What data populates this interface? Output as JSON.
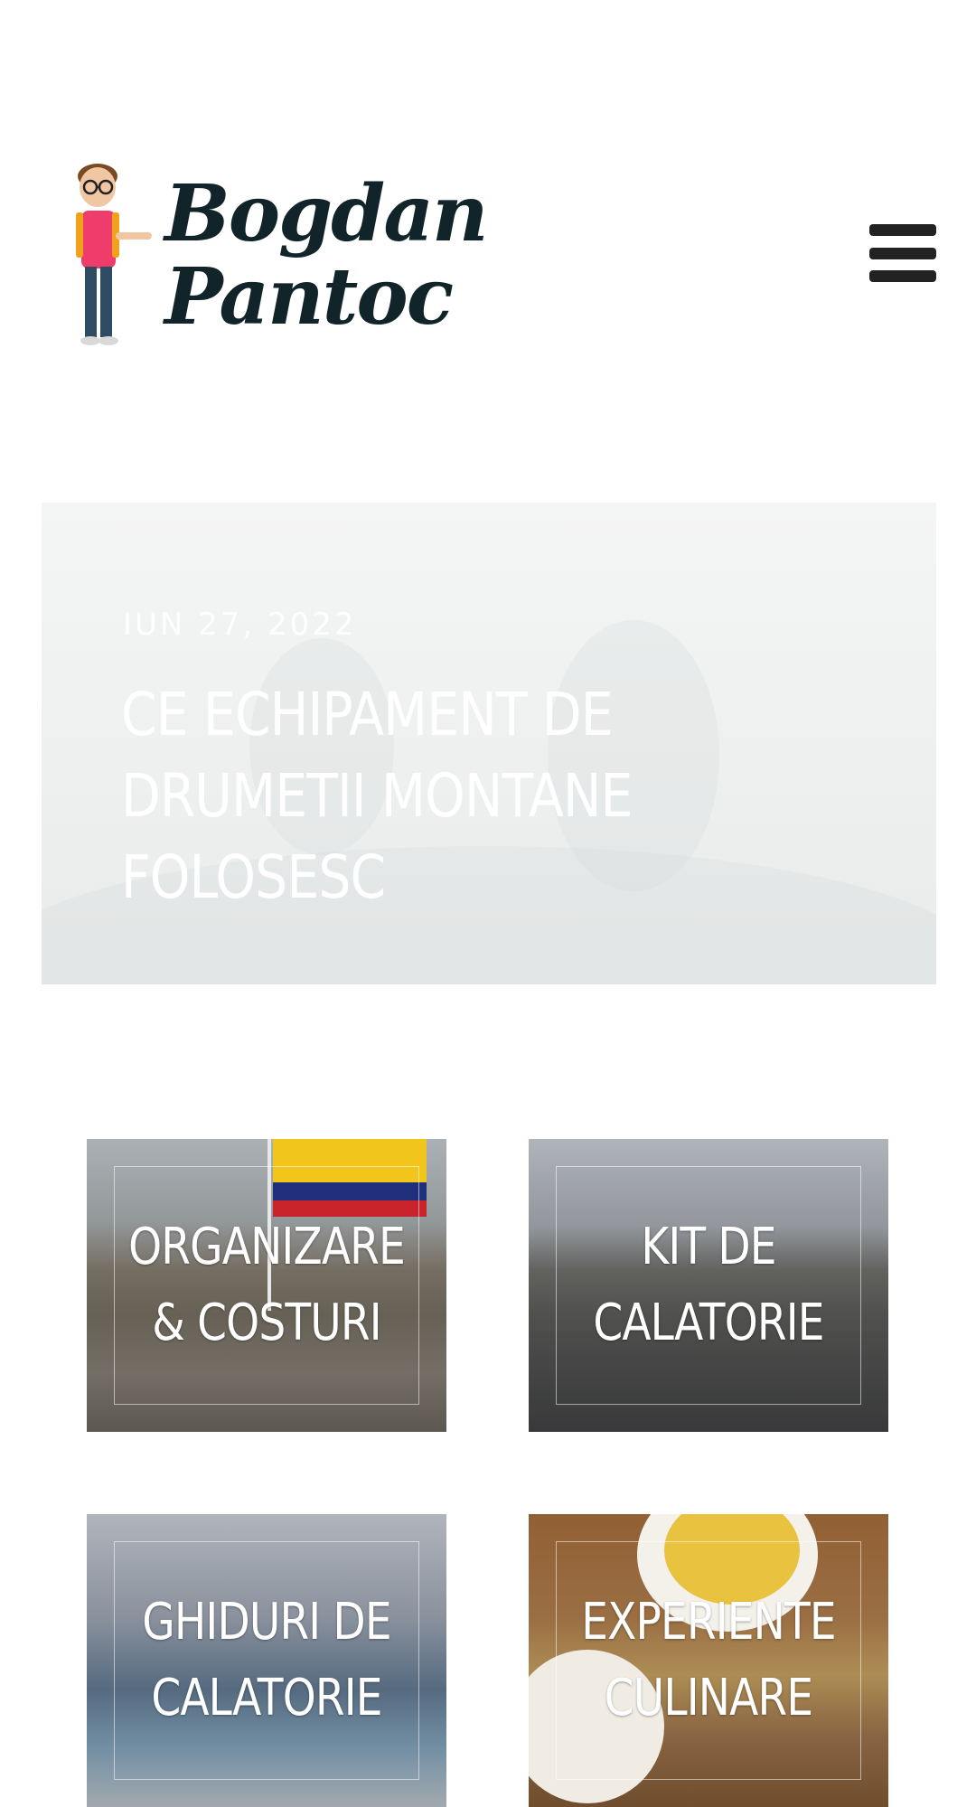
{
  "header": {
    "logo": {
      "line1": "Bogdan",
      "line2": "Pantoc"
    },
    "menu_icon": "hamburger-menu-icon"
  },
  "hero": {
    "date": "IUN 27, 2022",
    "title": "CE ECHIPAMENT DE DRUMETII MONTANE FOLOSESC"
  },
  "categories": [
    {
      "label": "ORGANIZARE & COSTURI"
    },
    {
      "label": "KIT DE CALATORIE"
    },
    {
      "label": "GHIDURI DE CALATORIE"
    },
    {
      "label": "EXPERIENTE CULINARE"
    }
  ],
  "colors": {
    "logo_text": "#11242a",
    "menu_icon": "#222222"
  }
}
